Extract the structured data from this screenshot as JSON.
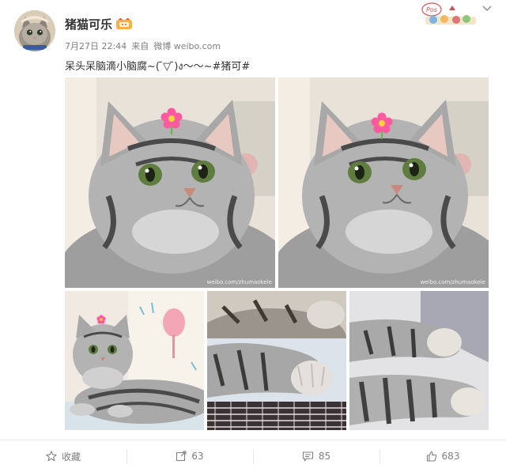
{
  "user": {
    "name": "猪猫可乐",
    "avatar_icon": "cat-avatar",
    "badge_icon": "vip-badge-icon"
  },
  "meta": {
    "date": "7月27日 22:44",
    "from_label": "来自",
    "source": "微博 weibo.com"
  },
  "post": {
    "text": "呆头呆脑滴小脑腐~(  ̄▽ ̄)ง〜〜~#猪可#"
  },
  "photos": [
    {
      "subject": "cat-face-closeup",
      "watermark": "weibo.com/zhumaokele"
    },
    {
      "subject": "cat-face-closeup",
      "watermark": "weibo.com/zhumaokele"
    },
    {
      "subject": "cat-lying"
    },
    {
      "subject": "cat-paws"
    },
    {
      "subject": "cat-paw"
    }
  ],
  "actions": {
    "favorite_label": "收藏",
    "repost_count": "63",
    "comment_count": "85",
    "like_count": "683"
  },
  "colors": {
    "text": "#333333",
    "meta": "#808080",
    "divider": "#e6e6e6",
    "accent": "#eb7350"
  }
}
